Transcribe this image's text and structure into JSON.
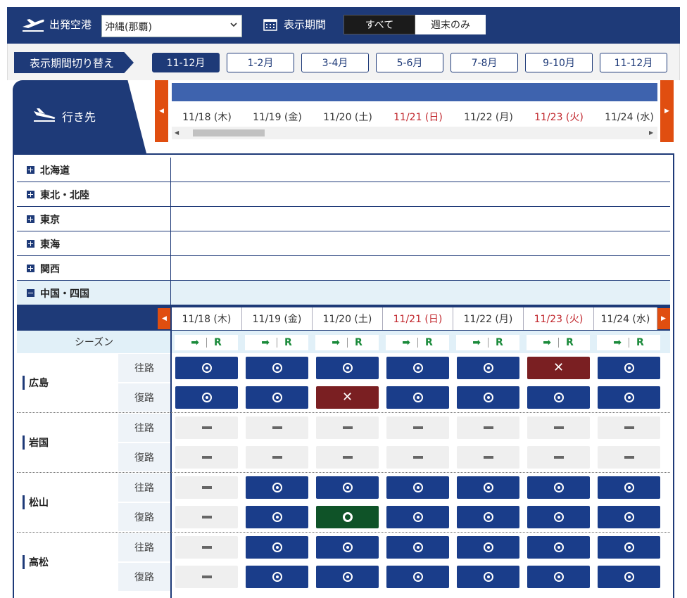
{
  "header": {
    "departure_label": "出発空港",
    "departure_value": "沖縄(那覇)",
    "period_label": "表示期間",
    "toggle_all": "すべて",
    "toggle_weekend": "週末のみ"
  },
  "period_switch": {
    "label": "表示期間切り替え",
    "tabs": [
      "11-12月",
      "1-2月",
      "3-4月",
      "5-6月",
      "7-8月",
      "9-10月",
      "11-12月"
    ],
    "active_index": 0
  },
  "destination_label": "行き先",
  "dates": [
    {
      "label": "11/18 (木)",
      "holiday": false
    },
    {
      "label": "11/19 (金)",
      "holiday": false
    },
    {
      "label": "11/20 (土)",
      "holiday": false
    },
    {
      "label": "11/21 (日)",
      "holiday": true
    },
    {
      "label": "11/22 (月)",
      "holiday": false
    },
    {
      "label": "11/23 (火)",
      "holiday": true
    },
    {
      "label": "11/24 (水)",
      "holiday": false
    }
  ],
  "regions": [
    {
      "name": "北海道",
      "expanded": false
    },
    {
      "name": "東北・北陸",
      "expanded": false
    },
    {
      "name": "東京",
      "expanded": false
    },
    {
      "name": "東海",
      "expanded": false
    },
    {
      "name": "関西",
      "expanded": false
    },
    {
      "name": "中国・四国",
      "expanded": true
    }
  ],
  "season_label": "シーズン",
  "trip_marker": "R",
  "direction_labels": {
    "out": "往路",
    "ret": "復路"
  },
  "cities": [
    {
      "name": "広島",
      "out": [
        "avail",
        "avail",
        "avail",
        "avail",
        "avail",
        "full",
        "avail"
      ],
      "ret": [
        "avail",
        "avail",
        "full",
        "avail",
        "avail",
        "avail",
        "avail"
      ]
    },
    {
      "name": "岩国",
      "out": [
        "none",
        "none",
        "none",
        "none",
        "none",
        "none",
        "none"
      ],
      "ret": [
        "none",
        "none",
        "none",
        "none",
        "none",
        "none",
        "none"
      ]
    },
    {
      "name": "松山",
      "out": [
        "none",
        "avail",
        "avail",
        "avail",
        "avail",
        "avail",
        "avail"
      ],
      "ret": [
        "none",
        "avail",
        "few",
        "avail",
        "avail",
        "avail",
        "avail"
      ]
    },
    {
      "name": "高松",
      "out": [
        "none",
        "avail",
        "avail",
        "avail",
        "avail",
        "avail",
        "avail"
      ],
      "ret": [
        "none",
        "avail",
        "avail",
        "avail",
        "avail",
        "avail",
        "avail"
      ]
    }
  ],
  "colors": {
    "navy": "#1e3a78",
    "available": "#1a3d8a",
    "full": "#7a1f22",
    "few": "#0f5328",
    "holiday_text": "#c1272d",
    "accent_orange": "#e04e10"
  },
  "icons": {
    "available": "dot-circle-icon",
    "full": "x-icon",
    "few": "ring-icon",
    "none": "dash-icon"
  }
}
